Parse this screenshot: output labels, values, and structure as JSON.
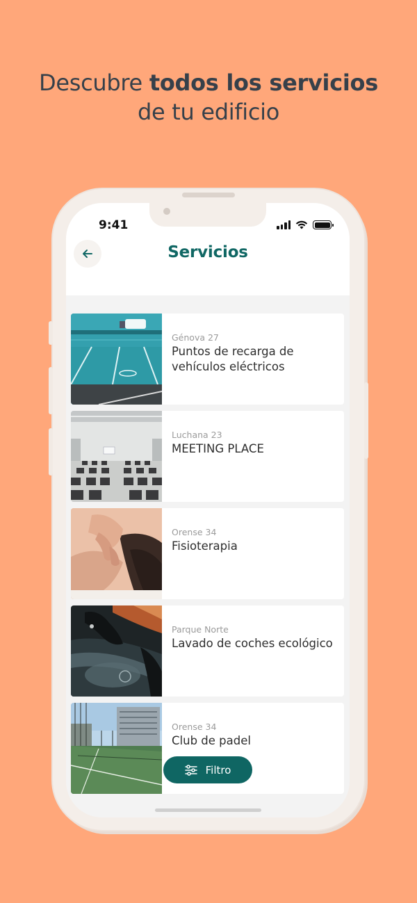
{
  "headline": {
    "normal": "Descubre ",
    "bold": "todos los servicios",
    "line2": "de tu edificio"
  },
  "status_bar": {
    "time": "9:41"
  },
  "header": {
    "title": "Servicios",
    "back_icon": "arrow-left-icon"
  },
  "services": [
    {
      "location": "Génova 27",
      "name": "Puntos de recarga de vehículos eléctricos",
      "image": "ev-charging-parking"
    },
    {
      "location": "Luchana 23",
      "name": "MEETING PLACE",
      "image": "conference-room"
    },
    {
      "location": "Orense 34",
      "name": "Fisioterapia",
      "image": "massage"
    },
    {
      "location": "Parque Norte",
      "name": "Lavado de coches ecológico",
      "image": "car-wash"
    },
    {
      "location": "Orense 34",
      "name": "Club de padel",
      "image": "padel-court"
    }
  ],
  "filter_button": {
    "label": "Filtro",
    "icon": "sliders-icon"
  },
  "colors": {
    "background": "#FFA77A",
    "brand": "#106764",
    "headline": "#36404A"
  }
}
